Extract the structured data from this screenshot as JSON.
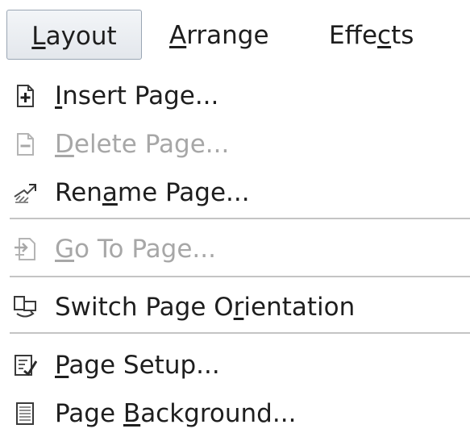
{
  "menubar": {
    "items": [
      {
        "label_pre": "",
        "label_ul": "L",
        "label_post": "ayout"
      },
      {
        "label_pre": "",
        "label_ul": "A",
        "label_post": "rrange"
      },
      {
        "label_pre": "Effe",
        "label_ul": "c",
        "label_post": "ts"
      }
    ]
  },
  "menu": {
    "items": [
      {
        "pre": "",
        "ul": "I",
        "post": "nsert Page...",
        "icon": "insert-page-icon",
        "enabled": true
      },
      {
        "pre": "",
        "ul": "D",
        "post": "elete Page...",
        "icon": "delete-page-icon",
        "enabled": false
      },
      {
        "pre": "Ren",
        "ul": "a",
        "post": "me Page...",
        "icon": "rename-page-icon",
        "enabled": true
      },
      {
        "pre": "",
        "ul": "G",
        "post": "o To Page...",
        "icon": "go-to-page-icon",
        "enabled": false
      },
      {
        "pre": "Switch Page O",
        "ul": "r",
        "post": "ientation",
        "icon": "switch-orientation-icon",
        "enabled": true
      },
      {
        "pre": "",
        "ul": "P",
        "post": "age Setup...",
        "icon": "page-setup-icon",
        "enabled": true
      },
      {
        "pre": "Page ",
        "ul": "B",
        "post": "ackground...",
        "icon": "page-background-icon",
        "enabled": true
      }
    ]
  },
  "colors": {
    "text": "#1e1e1e",
    "disabled": "#a7a7a7",
    "separator": "#c4c4c4"
  }
}
